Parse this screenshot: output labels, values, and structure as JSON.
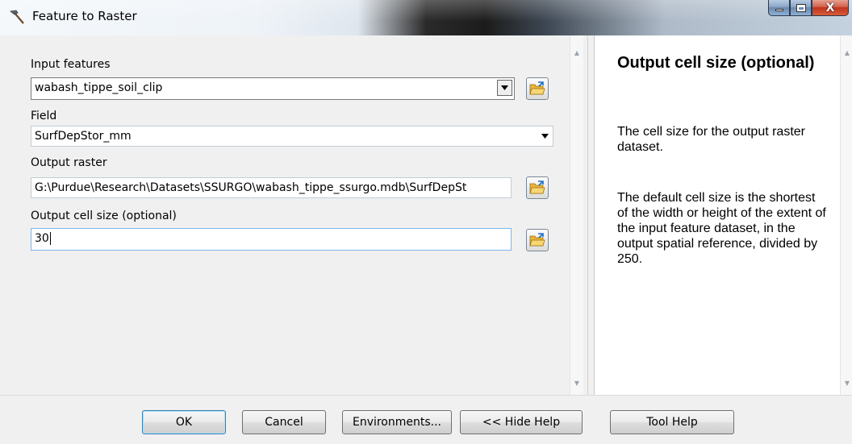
{
  "window": {
    "title": "Feature to Raster"
  },
  "params": {
    "input_features": {
      "label": "Input features",
      "value": "wabash_tippe_soil_clip"
    },
    "field": {
      "label": "Field",
      "value": "SurfDepStor_mm"
    },
    "output_raster": {
      "label": "Output raster",
      "value": "G:\\Purdue\\Research\\Datasets\\SSURGO\\wabash_tippe_ssurgo.mdb\\SurfDepSt"
    },
    "cell_size": {
      "label": "Output cell size (optional)",
      "value": "30"
    }
  },
  "help": {
    "title": "Output cell size (optional)",
    "paragraph1": "The cell size for the output raster dataset.",
    "paragraph2": "The default cell size is the shortest of the width or height of the extent of the input feature dataset, in the output spatial reference, divided by 250."
  },
  "buttons": {
    "ok": "OK",
    "cancel": "Cancel",
    "environments": "Environments...",
    "hide_help": "<< Hide Help",
    "tool_help": "Tool Help"
  },
  "colors": {
    "folder": "#f2c94c",
    "folder_arrow": "#1f6fc4",
    "close_red": "#c0341d"
  }
}
